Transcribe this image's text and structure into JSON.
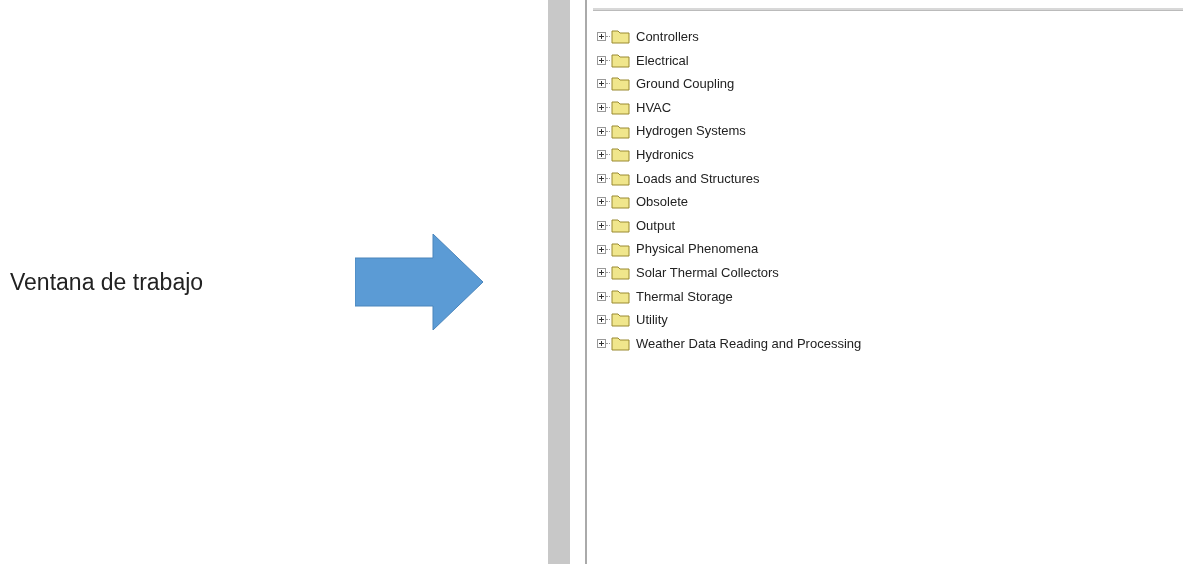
{
  "caption": "Ventana de trabajo",
  "tree": {
    "items": [
      {
        "label": "Controllers",
        "expanded": false
      },
      {
        "label": "Electrical",
        "expanded": false
      },
      {
        "label": "Ground Coupling",
        "expanded": false
      },
      {
        "label": "HVAC",
        "expanded": false
      },
      {
        "label": "Hydrogen Systems",
        "expanded": false
      },
      {
        "label": "Hydronics",
        "expanded": false
      },
      {
        "label": "Loads and Structures",
        "expanded": false
      },
      {
        "label": "Obsolete",
        "expanded": false
      },
      {
        "label": "Output",
        "expanded": false
      },
      {
        "label": "Physical Phenomena",
        "expanded": false
      },
      {
        "label": "Solar Thermal Collectors",
        "expanded": false
      },
      {
        "label": "Thermal Storage",
        "expanded": false
      },
      {
        "label": "Utility",
        "expanded": false
      },
      {
        "label": "Weather Data Reading and Processing",
        "expanded": false
      }
    ]
  }
}
